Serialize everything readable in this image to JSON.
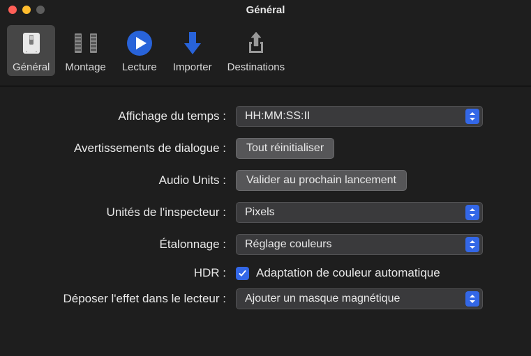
{
  "window": {
    "title": "Général"
  },
  "toolbar": {
    "items": [
      {
        "label": "Général",
        "selected": true
      },
      {
        "label": "Montage",
        "selected": false
      },
      {
        "label": "Lecture",
        "selected": false
      },
      {
        "label": "Importer",
        "selected": false
      },
      {
        "label": "Destinations",
        "selected": false
      }
    ]
  },
  "settings": {
    "time_display": {
      "label": "Affichage du temps :",
      "value": "HH:MM:SS:II"
    },
    "dialog_warnings": {
      "label": "Avertissements de dialogue :",
      "button": "Tout réinitialiser"
    },
    "audio_units": {
      "label": "Audio Units :",
      "button": "Valider au prochain lancement"
    },
    "inspector_units": {
      "label": "Unités de l'inspecteur :",
      "value": "Pixels"
    },
    "color_correction": {
      "label": "Étalonnage :",
      "value": "Réglage couleurs"
    },
    "hdr": {
      "label": "HDR :",
      "checkbox_label": "Adaptation de couleur automatique",
      "checked": true
    },
    "drop_effect": {
      "label": "Déposer l'effet dans le lecteur :",
      "value": "Ajouter un masque magnétique"
    }
  }
}
